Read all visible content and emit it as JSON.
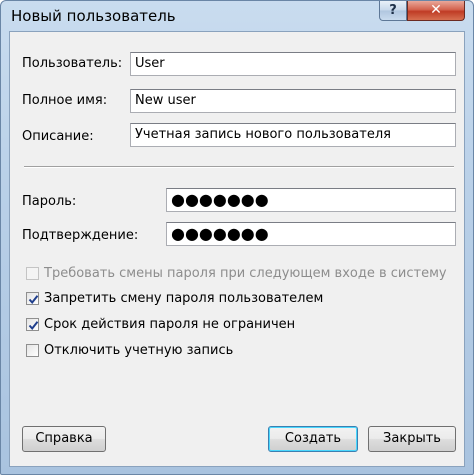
{
  "window": {
    "title": "Новый пользователь",
    "help_label": "?",
    "close_label": "✕"
  },
  "form": {
    "user": {
      "label": "Пользователь:",
      "value": "User"
    },
    "full_name": {
      "label": "Полное имя:",
      "value": "New user"
    },
    "description": {
      "label": "Описание:",
      "value": "Учетная запись нового пользователя"
    },
    "password": {
      "label": "Пароль:",
      "value": "●●●●●●●"
    },
    "confirm": {
      "label": "Подтверждение:",
      "value": "●●●●●●●"
    }
  },
  "checkboxes": [
    {
      "label": "Требовать смены пароля при следующем входе в систему",
      "checked": false,
      "disabled": true
    },
    {
      "label": "Запретить смену пароля пользователем",
      "checked": true,
      "disabled": false
    },
    {
      "label": "Срок действия пароля не ограничен",
      "checked": true,
      "disabled": false
    },
    {
      "label": "Отключить учетную запись",
      "checked": false,
      "disabled": false
    }
  ],
  "buttons": {
    "help": "Справка",
    "create": "Создать",
    "close": "Закрыть"
  },
  "colors": {
    "check_mark": "#1f3e8c",
    "default_button_border": "#3c7fb1"
  }
}
